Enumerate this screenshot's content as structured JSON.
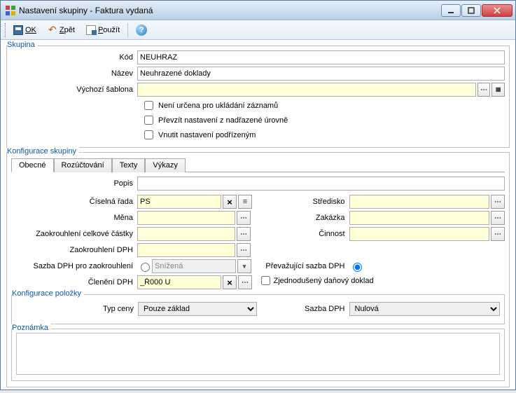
{
  "window": {
    "title": "Nastavení skupiny - Faktura vydaná"
  },
  "toolbar": {
    "ok": "OK",
    "undo": "Zpět",
    "apply": "Použít"
  },
  "group": {
    "legend": "Skupina",
    "code_label": "Kód",
    "code_value": "NEUHRAZ",
    "name_label": "Název",
    "name_value": "Neuhrazené doklady",
    "template_label": "Výchozí šablona",
    "template_value": "",
    "chk1": "Není určena pro ukládání záznamů",
    "chk2": "Převzít nastavení z nadřazené úrovně",
    "chk3": "Vnutit nastavení podřízeným"
  },
  "config": {
    "legend": "Konfigurace skupiny",
    "tabs": [
      "Obecné",
      "Rozúčtování",
      "Texty",
      "Výkazy"
    ],
    "active_tab": 0,
    "popis_label": "Popis",
    "popis_value": "",
    "cisrada_label": "Číselná řada",
    "cisrada_value": "PS",
    "mena_label": "Měna",
    "mena_value": "",
    "zaokc_label": "Zaokrouhlení celkové částky",
    "zaokc_value": "",
    "zaokdph_label": "Zaokrouhlení DPH",
    "zaokdph_value": "",
    "sazbazaok_label": "Sazba DPH pro zaokrouhlení",
    "sazbazaok_value": "Snížená",
    "clenenidph_label": "Členění DPH",
    "clenenidph_value": "_Ř000 U",
    "stredisko_label": "Středisko",
    "stredisko_value": "",
    "zakazka_label": "Zakázka",
    "zakazka_value": "",
    "cinnost_label": "Činnost",
    "cinnost_value": "",
    "prevaz_label": "Převažující sazba DPH",
    "zjedn_label": "Zjednodušený daňový doklad"
  },
  "item": {
    "legend": "Konfigurace položky",
    "typceny_label": "Typ ceny",
    "typceny_value": "Pouze základ",
    "sazbadph_label": "Sazba DPH",
    "sazbadph_value": "Nulová"
  },
  "note": {
    "legend": "Poznámka"
  }
}
